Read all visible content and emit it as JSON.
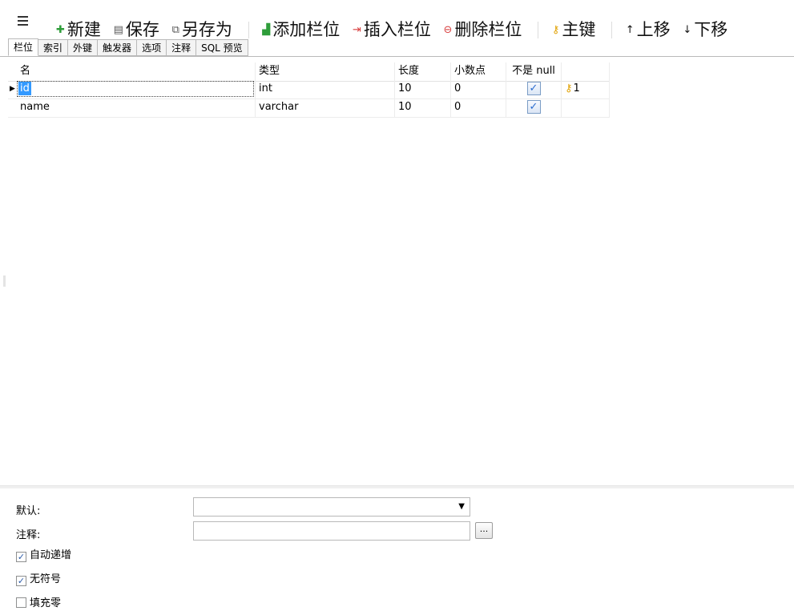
{
  "toolbar": {
    "buttons": [
      {
        "label": "新建",
        "icon": "new-icon",
        "glyph": "✚"
      },
      {
        "label": "保存",
        "icon": "save-icon",
        "glyph": "▤"
      },
      {
        "label": "另存为",
        "icon": "save-as-icon",
        "glyph": "⧉"
      },
      {
        "label": "添加栏位",
        "icon": "add-column-icon",
        "glyph": "▟"
      },
      {
        "label": "插入栏位",
        "icon": "insert-column-icon",
        "glyph": "⇥"
      },
      {
        "label": "删除栏位",
        "icon": "delete-column-icon",
        "glyph": "⊖"
      },
      {
        "label": "主键",
        "icon": "key-icon",
        "glyph": "⚷"
      },
      {
        "label": "上移",
        "icon": "arrow-up-icon",
        "glyph": "↑"
      },
      {
        "label": "下移",
        "icon": "arrow-down-icon",
        "glyph": "↓"
      }
    ]
  },
  "tabs": [
    "栏位",
    "索引",
    "外键",
    "触发器",
    "选项",
    "注释",
    "SQL 预览"
  ],
  "grid": {
    "headers": [
      "名",
      "类型",
      "长度",
      "小数点",
      "不是 null",
      ""
    ],
    "rows": [
      {
        "name": "id",
        "type": "int",
        "length": "10",
        "decimals": "0",
        "not_null": true,
        "key": "1",
        "selected": true
      },
      {
        "name": "name",
        "type": "varchar",
        "length": "10",
        "decimals": "0",
        "not_null": true,
        "key": "",
        "selected": false
      }
    ]
  },
  "properties": {
    "default_label": "默认:",
    "default_value": "",
    "comment_label": "注释:",
    "comment_value": "",
    "ellipsis": "...",
    "auto_increment_label": "自动递增",
    "auto_increment": true,
    "unsigned_label": "无符号",
    "unsigned": true,
    "zerofill_label": "填充零",
    "zerofill": false
  }
}
